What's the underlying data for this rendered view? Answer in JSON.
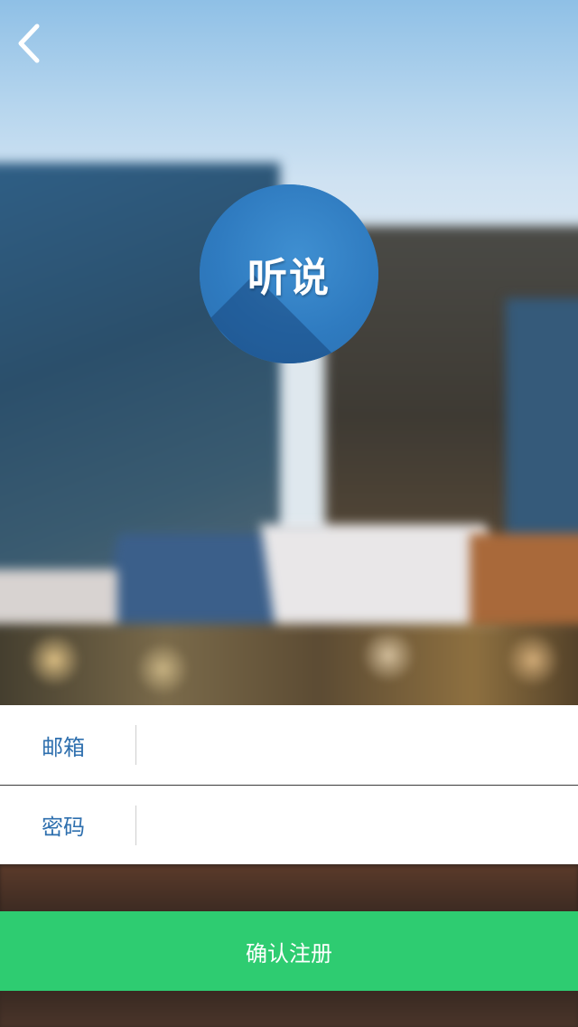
{
  "header": {
    "back_icon": "chevron-left-icon"
  },
  "logo": {
    "text": "听说",
    "color": "#2f7bc0"
  },
  "form": {
    "email_label": "邮箱",
    "email_value": "",
    "password_label": "密码",
    "password_value": ""
  },
  "submit": {
    "label": "确认注册",
    "color": "#2ecc71"
  }
}
